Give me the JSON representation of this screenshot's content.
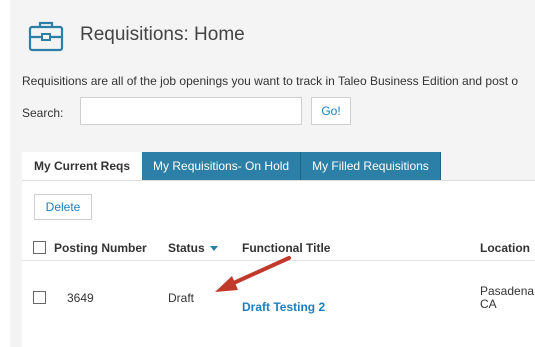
{
  "header": {
    "icon": "briefcase-icon",
    "title": "Requisitions: Home"
  },
  "intro_text": "Requisitions are all of the job openings you want to track in Taleo Business Edition and post o",
  "search": {
    "label": "Search:",
    "value": "",
    "placeholder": "",
    "go_label": "Go!"
  },
  "tabs": [
    {
      "label": "My Current Reqs",
      "active": true
    },
    {
      "label": "My Requisitions- On Hold",
      "active": false
    },
    {
      "label": "My Filled Requisitions",
      "active": false
    }
  ],
  "toolbar": {
    "delete_label": "Delete"
  },
  "table": {
    "columns": [
      "Posting Number",
      "Status",
      "Functional Title",
      "Location"
    ],
    "sort_column": "Status",
    "rows": [
      {
        "posting_number": "3649",
        "status": "Draft",
        "functional_title": "Draft Testing 2",
        "location_line1": "Pasadena,",
        "location_line2": "CA"
      }
    ]
  },
  "colors": {
    "tab_bg": "#2c7fa7",
    "link": "#1a7fc1",
    "annotation_arrow": "#c0392b",
    "panel_bg": "#f4f4f4"
  }
}
